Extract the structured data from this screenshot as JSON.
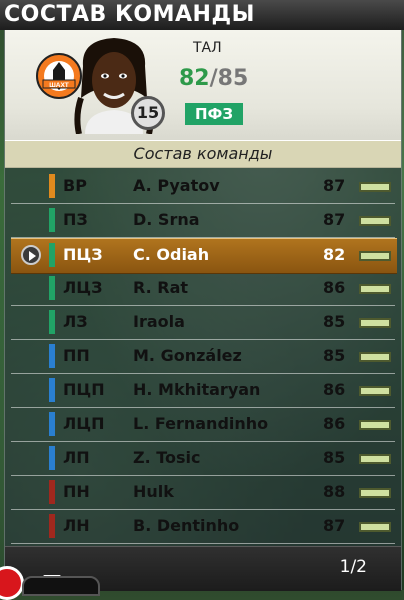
{
  "screen": {
    "title": "СОСТАВ КОМАНДЫ"
  },
  "player_card": {
    "team_code": "ТАЛ",
    "rating_current": "82",
    "rating_separator": "/",
    "rating_max": "85",
    "jersey_number": "15",
    "position": "ПФЗ",
    "crest_text": "ШАХТ",
    "accent_color": "#21a366"
  },
  "list": {
    "header": "Состав команды",
    "rows": [
      {
        "pos": "ВР",
        "name": "A. Pyatov",
        "ovr": "87",
        "color": "#e08a1e",
        "selected": false
      },
      {
        "pos": "ПЗ",
        "name": "D. Srna",
        "ovr": "87",
        "color": "#21a366",
        "selected": false
      },
      {
        "pos": "ПЦЗ",
        "name": "C. Odiah",
        "ovr": "82",
        "color": "#21a366",
        "selected": true
      },
      {
        "pos": "ЛЦЗ",
        "name": "R. Rat",
        "ovr": "86",
        "color": "#21a366",
        "selected": false
      },
      {
        "pos": "ЛЗ",
        "name": "Iraola",
        "ovr": "85",
        "color": "#21a366",
        "selected": false
      },
      {
        "pos": "ПП",
        "name": "M. González",
        "ovr": "85",
        "color": "#2a7fd0",
        "selected": false
      },
      {
        "pos": "ПЦП",
        "name": "H. Mkhitaryan",
        "ovr": "86",
        "color": "#2a7fd0",
        "selected": false
      },
      {
        "pos": "ЛЦП",
        "name": "L. Fernandinho",
        "ovr": "86",
        "color": "#2a7fd0",
        "selected": false
      },
      {
        "pos": "ЛП",
        "name": "Z. Tosic",
        "ovr": "85",
        "color": "#2a7fd0",
        "selected": false
      },
      {
        "pos": "ПН",
        "name": "Hulk",
        "ovr": "88",
        "color": "#a0281e",
        "selected": false
      },
      {
        "pos": "ЛН",
        "name": "B. Dentinho",
        "ovr": "87",
        "color": "#a0281e",
        "selected": false
      }
    ]
  },
  "footer": {
    "page_indicator": "1/2"
  }
}
